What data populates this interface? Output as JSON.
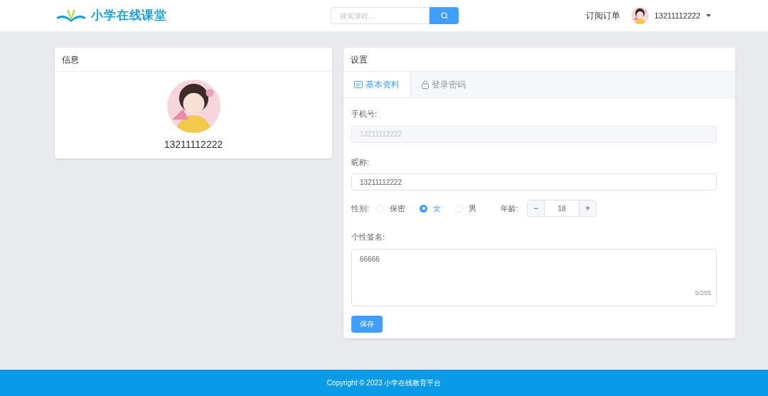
{
  "header": {
    "logo_text": "小学在线课堂",
    "search": {
      "placeholder": "搜索课程..."
    },
    "nav_link": "订阅订单",
    "user_name": "13211112222"
  },
  "info_card": {
    "title": "信息",
    "user_name": "13211112222"
  },
  "settings_card": {
    "title": "设置",
    "tabs": [
      {
        "label": "基本资料",
        "selected": true,
        "kind": "profile"
      },
      {
        "label": "登录密码",
        "selected": false,
        "kind": "lock"
      }
    ],
    "phone": {
      "label": "手机号:",
      "value": "13211112222",
      "disabled": true
    },
    "nickname": {
      "label": "昵称:",
      "value": "13211112222"
    },
    "gender": {
      "label": "性别:",
      "options": [
        {
          "label": "保密",
          "selected": false
        },
        {
          "label": "女",
          "selected": true
        },
        {
          "label": "男",
          "selected": false
        }
      ]
    },
    "age": {
      "label": "年龄:",
      "value": "18",
      "minus": "−",
      "plus": "+"
    },
    "signature": {
      "label": "个性签名:",
      "value": "66666",
      "counter": "5/255"
    },
    "save_button": "保存"
  },
  "footer": {
    "text": "Copyright © 2023 小学在线教育平台"
  }
}
